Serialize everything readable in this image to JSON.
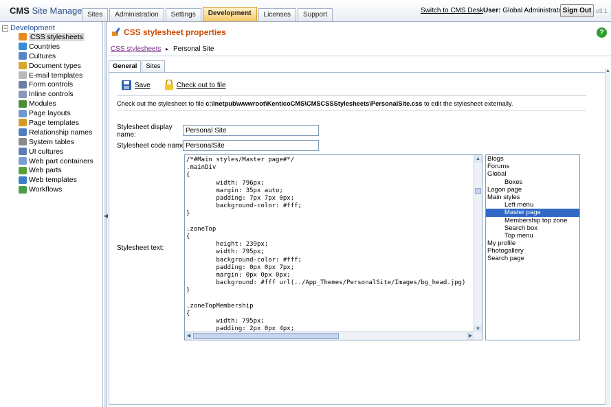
{
  "header": {
    "logo_cms": "CMS",
    "logo_rest": " Site Manager",
    "tabs": [
      "Sites",
      "Administration",
      "Settings",
      "Development",
      "Licenses",
      "Support"
    ],
    "active_tab": "Development",
    "switch_link": "Switch to CMS Desk",
    "user_label": "User:",
    "user_name": "Global Administrator",
    "signout": "Sign Out",
    "version": "v3.1"
  },
  "tree": {
    "root": "Development",
    "items": [
      {
        "label": "CSS stylesheets",
        "color": "#e58a1f"
      },
      {
        "label": "Countries",
        "color": "#3a8bd6"
      },
      {
        "label": "Cultures",
        "color": "#5a85c8"
      },
      {
        "label": "Document types",
        "color": "#d9a82a"
      },
      {
        "label": "E-mail templates",
        "color": "#b9b9b9"
      },
      {
        "label": "Form controls",
        "color": "#6b7fa6"
      },
      {
        "label": "Inline controls",
        "color": "#8899bb"
      },
      {
        "label": "Modules",
        "color": "#4a8f3a"
      },
      {
        "label": "Page layouts",
        "color": "#6f98cf"
      },
      {
        "label": "Page templates",
        "color": "#d69a2b"
      },
      {
        "label": "Relationship names",
        "color": "#4f7fc0"
      },
      {
        "label": "System tables",
        "color": "#8a8a8a"
      },
      {
        "label": "UI cultures",
        "color": "#5d7fb5"
      },
      {
        "label": "Web part containers",
        "color": "#7a9ecf"
      },
      {
        "label": "Web parts",
        "color": "#5aa03a"
      },
      {
        "label": "Web templates",
        "color": "#3f7fc9"
      },
      {
        "label": "Workflows",
        "color": "#4aa04a"
      }
    ],
    "selected": 0
  },
  "page": {
    "title": "CSS stylesheet properties",
    "breadcrumb_link": "CSS stylesheets",
    "breadcrumb_sep": "▸",
    "breadcrumb_current": "Personal Site",
    "subtabs": [
      "General",
      "Sites"
    ],
    "save": "Save",
    "checkout": "Check out to file",
    "info_pre": "Check out the stylesheet to file",
    "info_path": "c:\\Inetpub\\wwwroot\\KenticoCMS\\CMSCSSStylesheets\\PersonalSite.css",
    "info_post": "to edit the stylesheet externally.",
    "display_name_label": "Stylesheet display name:",
    "display_name_value": "Personal Site",
    "code_name_label": "Stylesheet code name:",
    "code_name_value": "PersonalSite",
    "text_label": "Stylesheet text:",
    "code_lines": [
      "/*#Main styles/Master page#*/",
      ".mainDiv",
      "{",
      "        width: 796px;",
      "        margin: 35px auto;",
      "        padding: 7px 7px 0px;",
      "        background-color: #fff;",
      "}",
      "",
      ".zoneTop",
      "{",
      "        height: 239px;",
      "        width: 795px;",
      "        background-color: #fff;",
      "        padding: 0px 0px 7px;",
      "        margin: 0px 0px 0px;",
      "        background: #fff url(../App_Themes/PersonalSite/Images/bg_head.jpg)",
      "}",
      "",
      ".zoneTopMembership",
      "{",
      "        width: 795px;",
      "        padding: 2px 0px 4px;"
    ],
    "sections": [
      {
        "label": "Blogs",
        "indent": 0
      },
      {
        "label": "Forums",
        "indent": 0
      },
      {
        "label": "Global",
        "indent": 0
      },
      {
        "label": "Boxes",
        "indent": 1
      },
      {
        "label": "Logon page",
        "indent": 0
      },
      {
        "label": "Main styles",
        "indent": 0
      },
      {
        "label": "Left menu",
        "indent": 1
      },
      {
        "label": "Master page",
        "indent": 1
      },
      {
        "label": "Membership top zone",
        "indent": 1
      },
      {
        "label": "Search box",
        "indent": 1
      },
      {
        "label": "Top menu",
        "indent": 1
      },
      {
        "label": "My profile",
        "indent": 0
      },
      {
        "label": "Photogallery",
        "indent": 0
      },
      {
        "label": "Search page",
        "indent": 0
      }
    ],
    "selected_section": "Master page"
  }
}
